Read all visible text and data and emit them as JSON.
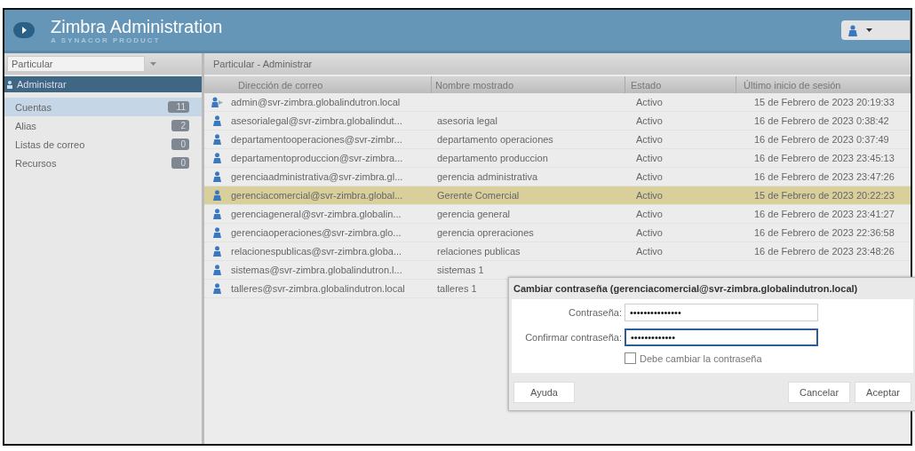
{
  "header": {
    "title": "Zimbra Administration",
    "subtitle": "A SYNACOR PRODUCT"
  },
  "sidebar": {
    "dropdown": "Particular",
    "section": "Administrar",
    "items": [
      {
        "label": "Cuentas",
        "count": "11",
        "selected": true
      },
      {
        "label": "Alias",
        "count": "2",
        "selected": false
      },
      {
        "label": "Listas de correo",
        "count": "0",
        "selected": false
      },
      {
        "label": "Recursos",
        "count": "0",
        "selected": false
      }
    ]
  },
  "breadcrumb": "Particular - Administrar",
  "table": {
    "columns": [
      "Dirección de correo",
      "Nombre mostrado",
      "Estado",
      "Último inicio de sesión"
    ],
    "rows": [
      {
        "kind": "admin",
        "cells": [
          "admin@svr-zimbra.globalindutron.local",
          "",
          "Activo",
          "15 de Febrero de 2023 20:19:33"
        ],
        "selected": false
      },
      {
        "kind": "user",
        "cells": [
          "asesorialegal@svr-zimbra.globalindut...",
          "asesoria legal",
          "Activo",
          "16 de Febrero de 2023 0:38:42"
        ],
        "selected": false
      },
      {
        "kind": "user",
        "cells": [
          "departamentooperaciones@svr-zimbr...",
          "departamento operaciones",
          "Activo",
          "16 de Febrero de 2023 0:37:49"
        ],
        "selected": false
      },
      {
        "kind": "user",
        "cells": [
          "departamentoproduccion@svr-zimbra...",
          "departamento produccion",
          "Activo",
          "16 de Febrero de 2023 23:45:13"
        ],
        "selected": false
      },
      {
        "kind": "user",
        "cells": [
          "gerenciaadministrativa@svr-zimbra.gl...",
          "gerencia administrativa",
          "Activo",
          "16 de Febrero de 2023 23:47:26"
        ],
        "selected": false
      },
      {
        "kind": "user",
        "cells": [
          "gerenciacomercial@svr-zimbra.global...",
          "Gerente Comercial",
          "Activo",
          "15 de Febrero de 2023 20:22:23"
        ],
        "selected": true
      },
      {
        "kind": "user",
        "cells": [
          "gerenciageneral@svr-zimbra.globalin...",
          "gerencia general",
          "Activo",
          "16 de Febrero de 2023 23:41:27"
        ],
        "selected": false
      },
      {
        "kind": "user",
        "cells": [
          "gerenciaoperaciones@svr-zimbra.glo...",
          "gerencia opreraciones",
          "Activo",
          "16 de Febrero de 2023 22:36:58"
        ],
        "selected": false
      },
      {
        "kind": "user",
        "cells": [
          "relacionespublicas@svr-zimbra.globa...",
          "relaciones publicas",
          "Activo",
          "16 de Febrero de 2023 23:48:26"
        ],
        "selected": false
      },
      {
        "kind": "user",
        "cells": [
          "sistemas@svr-zimbra.globalindutron.l...",
          "sistemas 1",
          "",
          ""
        ],
        "selected": false
      },
      {
        "kind": "user",
        "cells": [
          "talleres@svr-zimbra.globalindutron.local",
          "talleres 1",
          "",
          ""
        ],
        "selected": false
      }
    ]
  },
  "dialog": {
    "title": "Cambiar contraseña (gerenciacomercial@svr-zimbra.globalindutron.local)",
    "fields": [
      {
        "label": "Contraseña:",
        "value": "•••••••••••••••",
        "focused": false
      },
      {
        "label": "Confirmar contraseña:",
        "value": "•••••••••••••",
        "focused": true
      }
    ],
    "checkbox": {
      "label": "Debe cambiar la contraseña",
      "checked": false
    },
    "buttons": [
      "Ayuda",
      "Cancelar",
      "Aceptar"
    ]
  }
}
